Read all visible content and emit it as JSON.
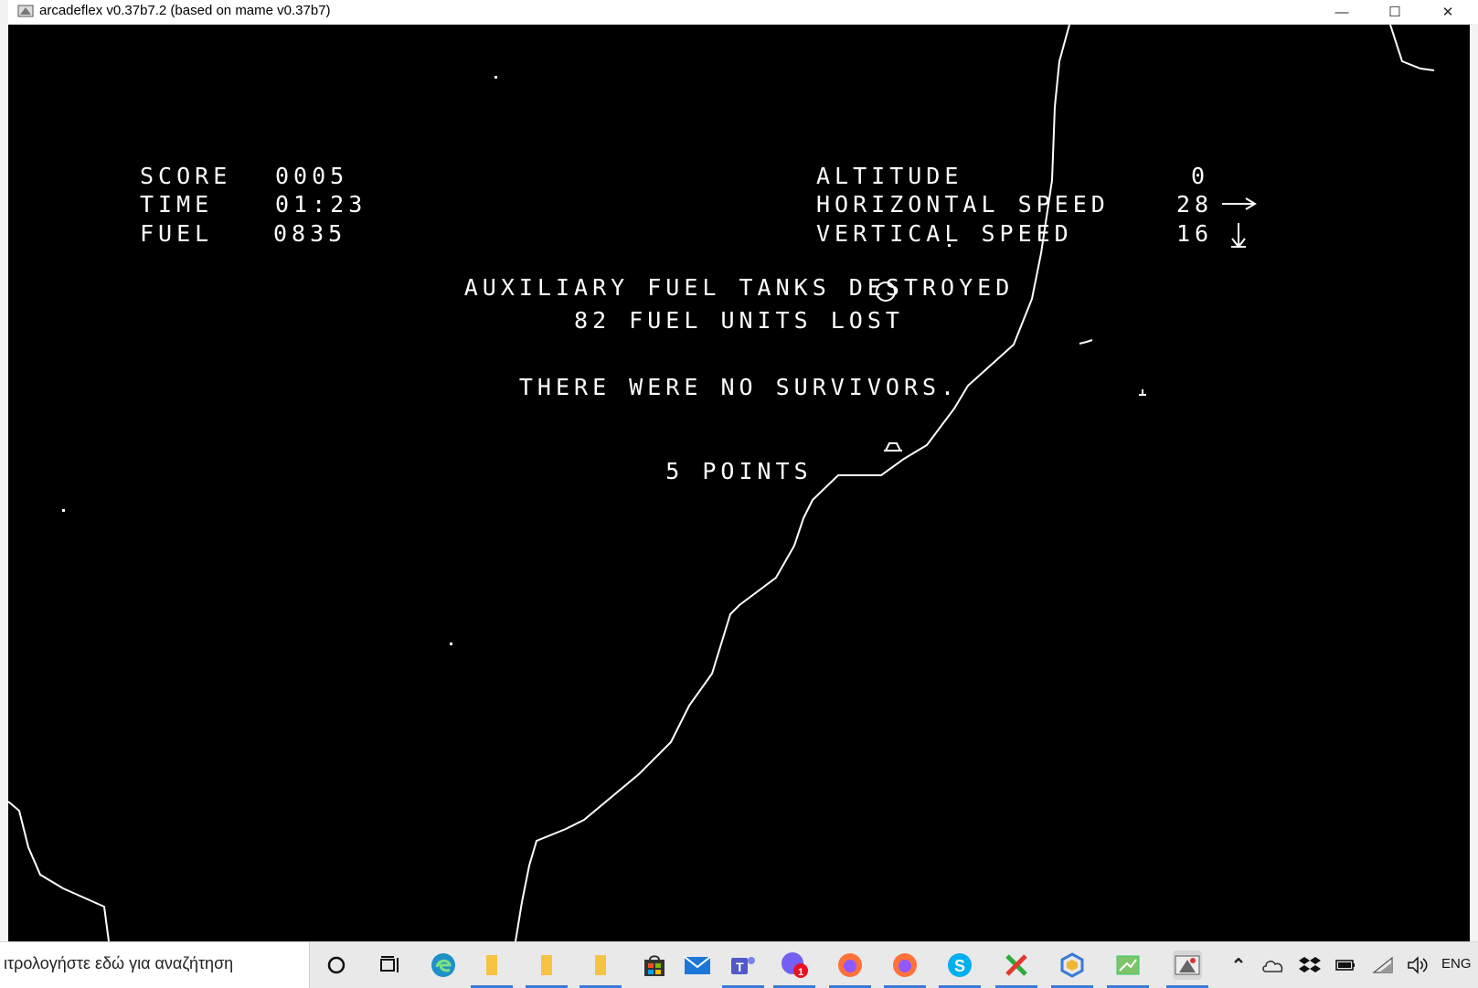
{
  "window": {
    "title": "arcadeflex v0.37b7.2 (based on mame v0.37b7)",
    "minimize_glyph": "—",
    "maximize_glyph": "☐",
    "close_glyph": "✕"
  },
  "hud": {
    "score_label": "SCORE",
    "score_value": "0005",
    "time_label": "TIME",
    "time_value": "01:23",
    "fuel_label": "FUEL",
    "fuel_value": "0835",
    "altitude_label": "ALTITUDE",
    "altitude_value": "0",
    "hspeed_label": "HORIZONTAL SPEED",
    "hspeed_value": "28",
    "vspeed_label": "VERTICAL SPEED",
    "vspeed_value": "16"
  },
  "messages": {
    "line1": "AUXILIARY FUEL TANKS DESTROYED",
    "line2": "82 FUEL UNITS LOST",
    "line3": "THERE WERE NO SURVIVORS.",
    "line4": "5 POINTS"
  },
  "taskbar": {
    "search_placeholder": "ιτρολογήστε εδώ για αναζήτηση",
    "language": "ENG",
    "notification_badge": "1",
    "icons": [
      "cortana-icon",
      "task-view-icon",
      "edge-icon",
      "file-explorer-icon",
      "file-explorer-icon-2",
      "file-explorer-icon-3",
      "store-icon",
      "mail-icon",
      "teams-icon",
      "viber-icon",
      "firefox-icon",
      "firefox-icon-2",
      "skype-icon",
      "xming-icon",
      "vpn-icon",
      "notepad-icon",
      "arcadeflex-icon"
    ],
    "colors": {
      "accent": "#3a7bd5",
      "taskbar_bg": "#e9e9ea",
      "game_bg": "#000000",
      "game_fg": "#ffffff"
    }
  }
}
